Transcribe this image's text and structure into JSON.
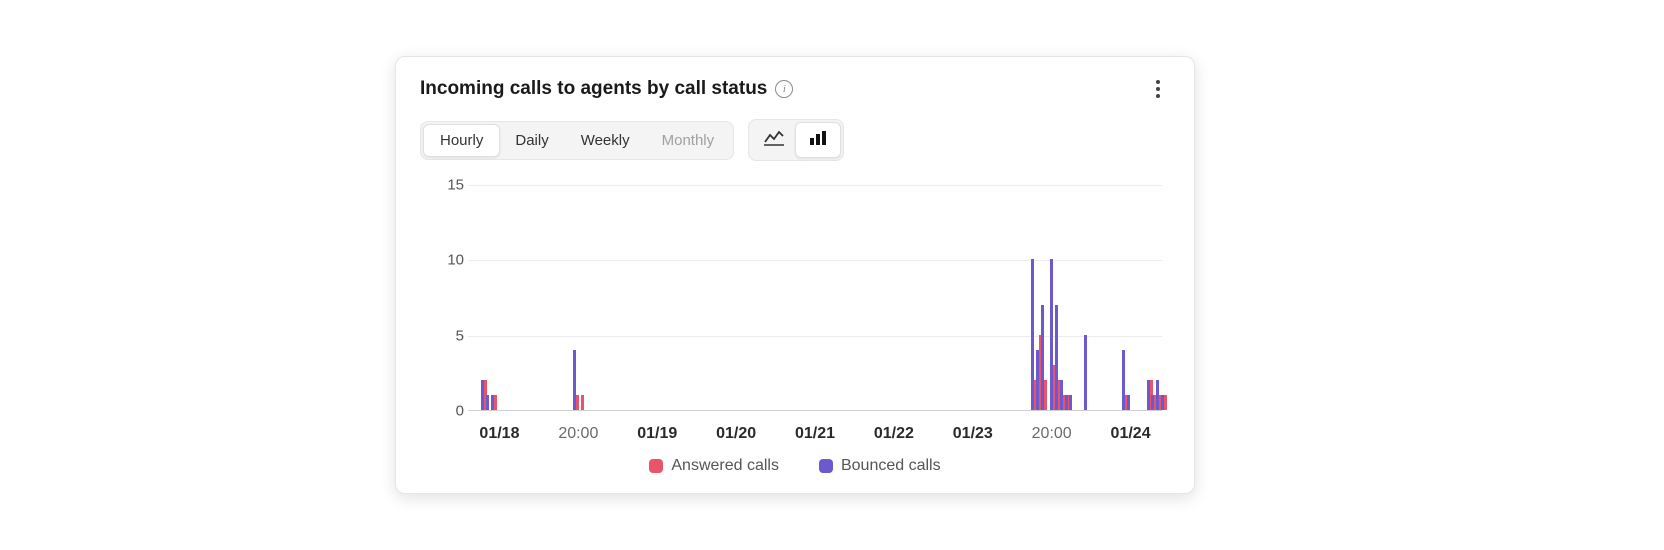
{
  "card": {
    "title": "Incoming calls to agents by call status"
  },
  "toolbar": {
    "granularity": {
      "options": [
        "Hourly",
        "Daily",
        "Weekly",
        "Monthly"
      ],
      "active_index": 0,
      "disabled_index": 3
    },
    "chart_type": {
      "active": "bar"
    }
  },
  "legend": {
    "answered": {
      "label": "Answered calls",
      "color": "#e8556a"
    },
    "bounced": {
      "label": "Bounced calls",
      "color": "#6a5acd"
    }
  },
  "chart_data": {
    "type": "bar",
    "granularity": "hourly",
    "ylabel": "",
    "xlabel": "",
    "ylim": [
      0,
      15
    ],
    "y_ticks": [
      0,
      5,
      10,
      15
    ],
    "x_ticks": [
      {
        "label": "01/18",
        "bold": true,
        "hour_index": 0
      },
      {
        "label": "20:00",
        "bold": false,
        "hour_index": 20
      },
      {
        "label": "01/19",
        "bold": true,
        "hour_index": 24
      },
      {
        "label": "01/20",
        "bold": true,
        "hour_index": 48
      },
      {
        "label": "01/21",
        "bold": true,
        "hour_index": 72
      },
      {
        "label": "01/22",
        "bold": true,
        "hour_index": 96
      },
      {
        "label": "01/23",
        "bold": true,
        "hour_index": 120
      },
      {
        "label": "20:00",
        "bold": false,
        "hour_index": 140
      },
      {
        "label": "01/24",
        "bold": true,
        "hour_index": 144
      }
    ],
    "total_hours": 144,
    "series": [
      {
        "name": "Answered calls",
        "color": "#e8556a",
        "key": "answered"
      },
      {
        "name": "Bounced calls",
        "color": "#6a5acd",
        "key": "bounced"
      }
    ],
    "points": [
      {
        "hour_index": 3,
        "answered": 2,
        "bounced": 2
      },
      {
        "hour_index": 4,
        "answered": 0,
        "bounced": 1
      },
      {
        "hour_index": 5,
        "answered": 1,
        "bounced": 1
      },
      {
        "hour_index": 22,
        "answered": 1,
        "bounced": 4
      },
      {
        "hour_index": 23,
        "answered": 1,
        "bounced": 0
      },
      {
        "hour_index": 117,
        "answered": 2,
        "bounced": 10
      },
      {
        "hour_index": 118,
        "answered": 5,
        "bounced": 4
      },
      {
        "hour_index": 119,
        "answered": 2,
        "bounced": 7
      },
      {
        "hour_index": 121,
        "answered": 3,
        "bounced": 10
      },
      {
        "hour_index": 122,
        "answered": 2,
        "bounced": 7
      },
      {
        "hour_index": 123,
        "answered": 1,
        "bounced": 2
      },
      {
        "hour_index": 124,
        "answered": 1,
        "bounced": 1
      },
      {
        "hour_index": 125,
        "answered": 0,
        "bounced": 1
      },
      {
        "hour_index": 128,
        "answered": 0,
        "bounced": 5
      },
      {
        "hour_index": 136,
        "answered": 1,
        "bounced": 4
      },
      {
        "hour_index": 137,
        "answered": 0,
        "bounced": 1
      },
      {
        "hour_index": 141,
        "answered": 2,
        "bounced": 2
      },
      {
        "hour_index": 142,
        "answered": 1,
        "bounced": 1
      },
      {
        "hour_index": 143,
        "answered": 1,
        "bounced": 2
      },
      {
        "hour_index": 144,
        "answered": 1,
        "bounced": 1
      }
    ]
  }
}
